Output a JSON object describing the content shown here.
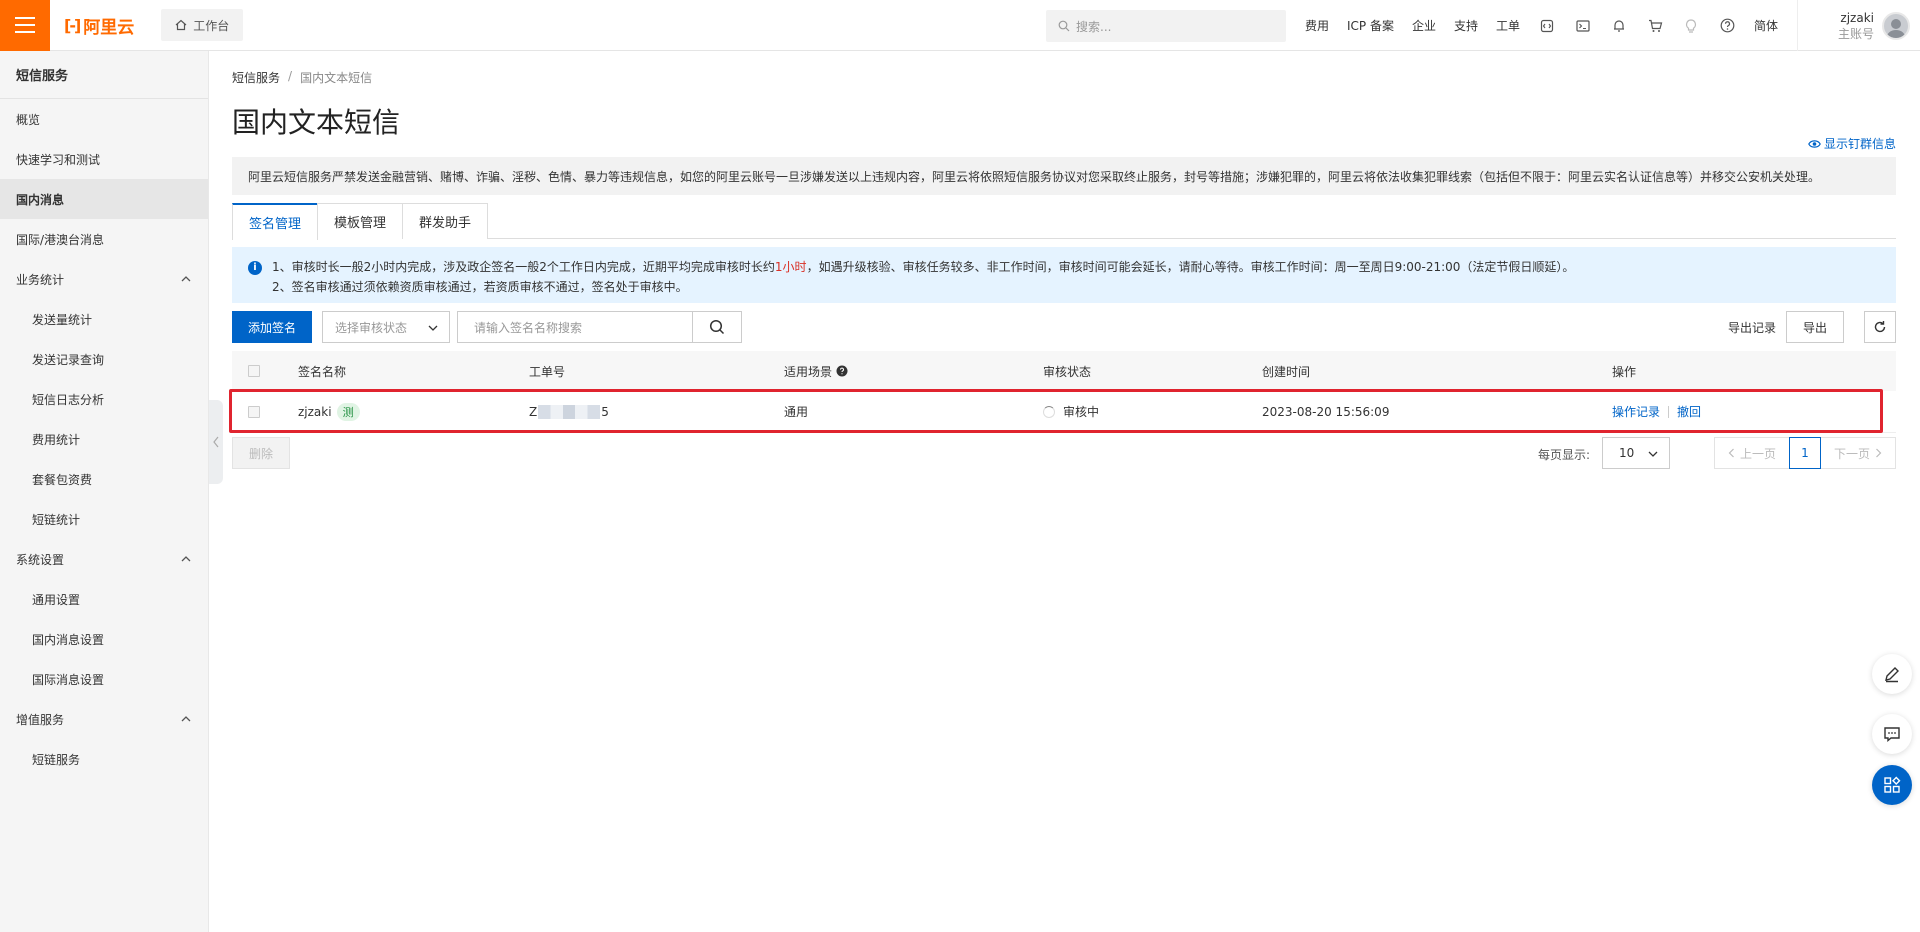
{
  "topbar": {
    "logo_text": "阿里云",
    "workbench_label": "工作台",
    "search_placeholder": "搜索...",
    "nav": [
      "费用",
      "ICP 备案",
      "企业",
      "支持",
      "工单"
    ],
    "lang": "简体",
    "user_name": "zjzaki",
    "user_role": "主账号",
    "icons": [
      "ide-icon",
      "terminal-icon",
      "bell-icon",
      "cart-icon",
      "bulb-icon",
      "help-icon"
    ]
  },
  "sidebar": {
    "title": "短信服务",
    "items": [
      {
        "label": "概览",
        "type": "item"
      },
      {
        "label": "快速学习和测试",
        "type": "item"
      },
      {
        "label": "国内消息",
        "type": "item",
        "active": true
      },
      {
        "label": "国际/港澳台消息",
        "type": "item"
      },
      {
        "label": "业务统计",
        "type": "group"
      },
      {
        "label": "发送量统计",
        "type": "sub"
      },
      {
        "label": "发送记录查询",
        "type": "sub"
      },
      {
        "label": "短信日志分析",
        "type": "sub"
      },
      {
        "label": "费用统计",
        "type": "sub"
      },
      {
        "label": "套餐包资费",
        "type": "sub"
      },
      {
        "label": "短链统计",
        "type": "sub"
      },
      {
        "label": "系统设置",
        "type": "group"
      },
      {
        "label": "通用设置",
        "type": "sub"
      },
      {
        "label": "国内消息设置",
        "type": "sub"
      },
      {
        "label": "国际消息设置",
        "type": "sub"
      },
      {
        "label": "增值服务",
        "type": "group"
      },
      {
        "label": "短链服务",
        "type": "sub"
      }
    ]
  },
  "main": {
    "breadcrumb": [
      "短信服务",
      "国内文本短信"
    ],
    "breadcrumb_sep": "/",
    "title": "国内文本短信",
    "show_ding": "显示钉群信息",
    "warning": "阿里云短信服务严禁发送金融营销、赌博、诈骗、淫秽、色情、暴力等违规信息，如您的阿里云账号一旦涉嫌发送以上违规内容，阿里云将依照短信服务协议对您采取终止服务，封号等措施；涉嫌犯罪的，阿里云将依法收集犯罪线索（包括但不限于：阿里云实名认证信息等）并移交公安机关处理。",
    "tabs": [
      "签名管理",
      "模板管理",
      "群发助手"
    ],
    "info_line1_a": "1、审核时长一般2小时内完成，涉及政企签名一般2个工作日内完成，近期平均完成审核时长约",
    "info_line1_red": "1小时",
    "info_line1_b": "，如遇升级核验、审核任务较多、非工作时间，审核时间可能会延长，请耐心等待。审核工作时间：周一至周日9:00-21:00（法定节假日顺延）。",
    "info_line2": "2、签名审核通过须依赖资质审核通过，若资质审核不通过，签名处于审核中。",
    "add_button": "添加签名",
    "status_placeholder": "选择审核状态",
    "search_placeholder": "请输入签名名称搜索",
    "export_records": "导出记录",
    "export": "导出",
    "columns": [
      "签名名称",
      "工单号",
      "适用场景",
      "审核状态",
      "创建时间",
      "操作"
    ],
    "rows": [
      {
        "name": "zjzaki",
        "tag": "测",
        "order_prefix": "Z",
        "order_suffix": "5",
        "scene": "通用",
        "status": "审核中",
        "created": "2023-08-20 15:56:09",
        "action_log": "操作记录",
        "action_revoke": "撤回"
      }
    ],
    "delete_button": "删除",
    "per_page_label": "每页显示:",
    "per_page_value": "10",
    "prev": "上一页",
    "next": "下一页",
    "page": "1"
  },
  "colors": {
    "brand": "#ff6a00",
    "primary": "#0064c8",
    "highlight": "#e0242f",
    "warn_red": "#d93026"
  }
}
